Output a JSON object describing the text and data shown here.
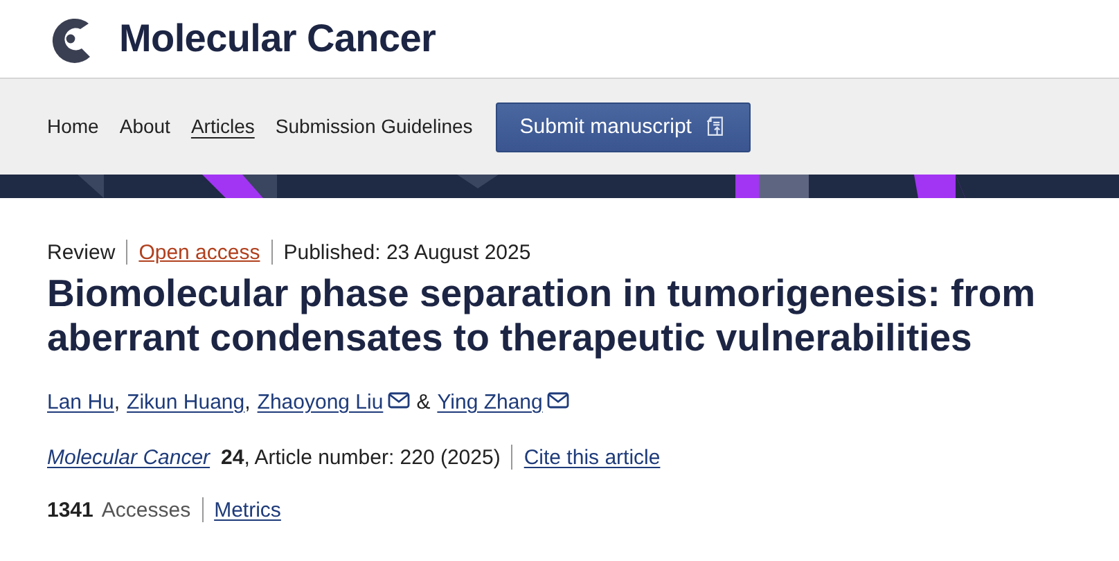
{
  "site": {
    "name": "Molecular Cancer"
  },
  "nav": {
    "items": [
      {
        "label": "Home",
        "selected": false
      },
      {
        "label": "About",
        "selected": false
      },
      {
        "label": "Articles",
        "selected": true
      },
      {
        "label": "Submission Guidelines",
        "selected": false
      }
    ],
    "submit_button": "Submit manuscript"
  },
  "article": {
    "type": "Review",
    "access": "Open access",
    "published": "Published: 23 August 2025",
    "title": "Biomolecular phase separation in tumorigenesis: from aberrant condensates to therapeutic vulnerabilities",
    "authors": [
      {
        "name": "Lan Hu",
        "email": false,
        "sep": ","
      },
      {
        "name": "Zikun Huang",
        "email": false,
        "sep": ","
      },
      {
        "name": "Zhaoyong Liu",
        "email": true,
        "sep": "&"
      },
      {
        "name": "Ying Zhang",
        "email": true
      }
    ],
    "journal": "Molecular Cancer",
    "citation": "**24**, Article number: 220 (2025)",
    "cite_link": "Cite this article",
    "accesses_count": "1341",
    "accesses_label": "Accesses",
    "metrics_link": "Metrics"
  }
}
